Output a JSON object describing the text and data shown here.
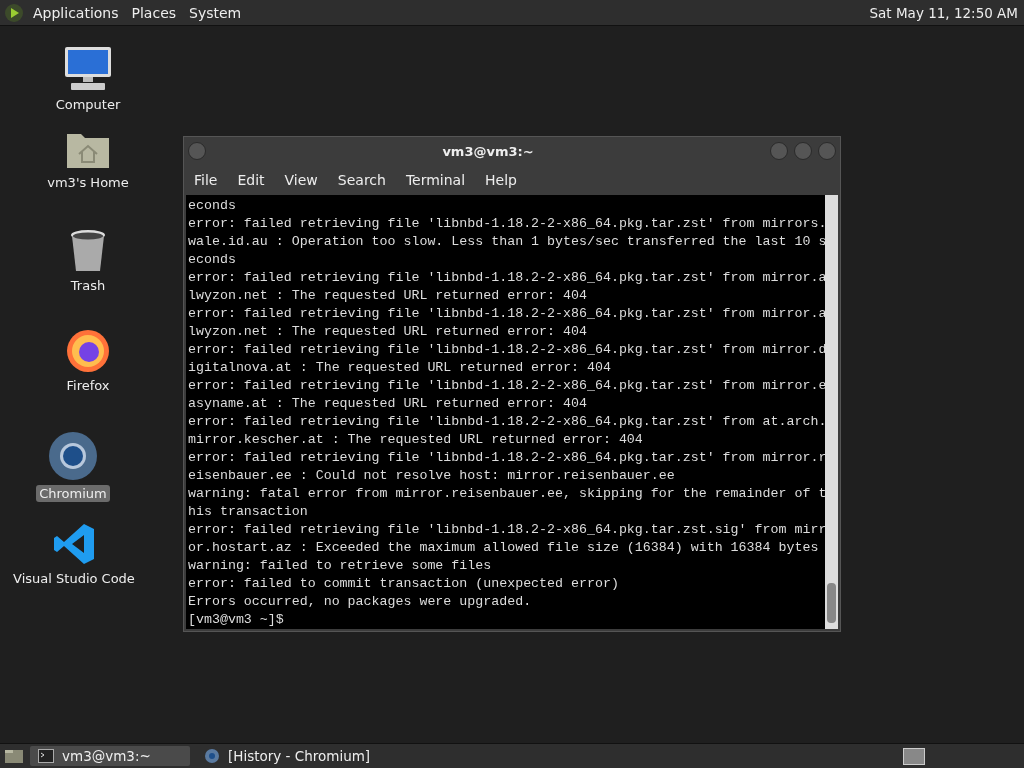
{
  "top_panel": {
    "menus": [
      "Applications",
      "Places",
      "System"
    ],
    "clock": "Sat May 11, 12:50 AM"
  },
  "desktop_icons": [
    {
      "kind": "computer",
      "label": "Computer",
      "selected": false
    },
    {
      "kind": "home",
      "label": "vm3's Home",
      "selected": false
    },
    {
      "kind": "trash",
      "label": "Trash",
      "selected": false
    },
    {
      "kind": "firefox",
      "label": "Firefox",
      "selected": false
    },
    {
      "kind": "chromium",
      "label": "Chromium",
      "selected": true
    },
    {
      "kind": "vscode",
      "label": "Visual Studio Code",
      "selected": false
    }
  ],
  "window": {
    "title": "vm3@vm3:~",
    "menu": [
      "File",
      "Edit",
      "View",
      "Search",
      "Terminal",
      "Help"
    ],
    "lines": [
      "econds",
      "error: failed retrieving file 'libnbd-1.18.2-2-x86_64.pkg.tar.zst' from mirrors.",
      "wale.id.au : Operation too slow. Less than 1 bytes/sec transferred the last 10 s",
      "econds",
      "error: failed retrieving file 'libnbd-1.18.2-2-x86_64.pkg.tar.zst' from mirror.a",
      "lwyzon.net : The requested URL returned error: 404",
      "error: failed retrieving file 'libnbd-1.18.2-2-x86_64.pkg.tar.zst' from mirror.a",
      "lwyzon.net : The requested URL returned error: 404",
      "error: failed retrieving file 'libnbd-1.18.2-2-x86_64.pkg.tar.zst' from mirror.d",
      "igitalnova.at : The requested URL returned error: 404",
      "error: failed retrieving file 'libnbd-1.18.2-2-x86_64.pkg.tar.zst' from mirror.e",
      "asyname.at : The requested URL returned error: 404",
      "error: failed retrieving file 'libnbd-1.18.2-2-x86_64.pkg.tar.zst' from at.arch.",
      "mirror.kescher.at : The requested URL returned error: 404",
      "error: failed retrieving file 'libnbd-1.18.2-2-x86_64.pkg.tar.zst' from mirror.r",
      "eisenbauer.ee : Could not resolve host: mirror.reisenbauer.ee",
      "warning: fatal error from mirror.reisenbauer.ee, skipping for the remainder of t",
      "his transaction",
      "error: failed retrieving file 'libnbd-1.18.2-2-x86_64.pkg.tar.zst.sig' from mirr",
      "or.hostart.az : Exceeded the maximum allowed file size (16384) with 16384 bytes",
      "warning: failed to retrieve some files",
      "error: failed to commit transaction (unexpected error)",
      "Errors occurred, no packages were upgraded."
    ],
    "prompt": "[vm3@vm3 ~]$"
  },
  "taskbar": [
    {
      "label": "vm3@vm3:~",
      "selected": true,
      "kind": "terminal"
    },
    {
      "label": "[History - Chromium]",
      "selected": false,
      "kind": "chromium"
    }
  ]
}
